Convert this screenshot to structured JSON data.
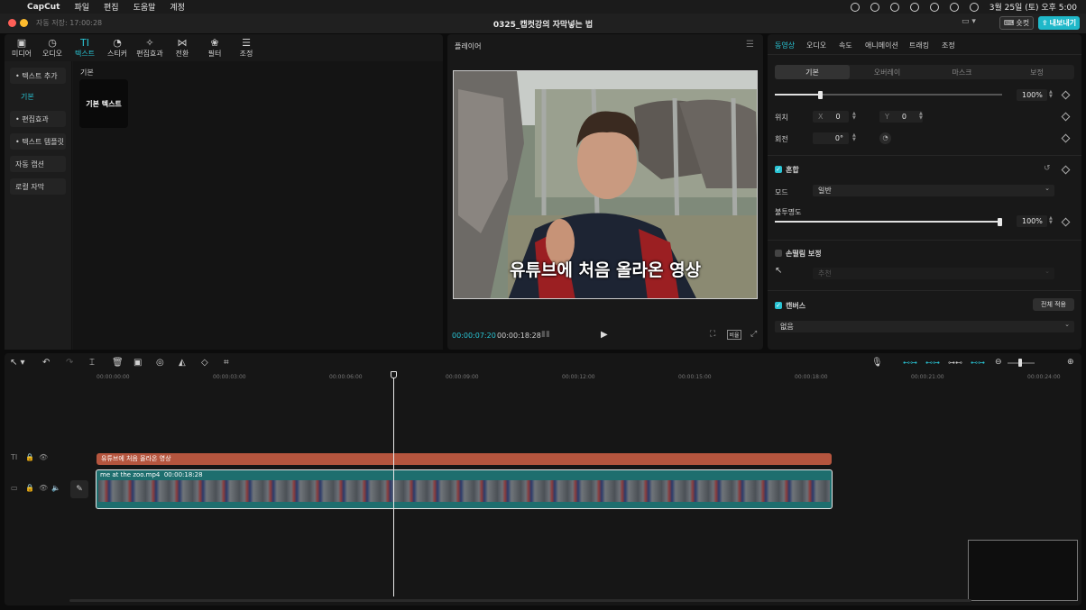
{
  "menubar": {
    "app": "CapCut",
    "items": [
      "파일",
      "편집",
      "도움말",
      "계정"
    ],
    "date_time": "3월 25일 (토) 오후 5:00"
  },
  "titlebar": {
    "autosave": "자동 저장: 17:00:28",
    "title": "0325_캡컷강의 자막넣는 법",
    "shortcut": "숏컷",
    "export": "내보내기"
  },
  "media_tabs": [
    {
      "label": "미디어",
      "icon": "media-icon"
    },
    {
      "label": "오디오",
      "icon": "audio-icon"
    },
    {
      "label": "텍스트",
      "icon": "text-icon"
    },
    {
      "label": "스티커",
      "icon": "sticker-icon"
    },
    {
      "label": "편집효과",
      "icon": "effects-icon"
    },
    {
      "label": "전환",
      "icon": "transition-icon"
    },
    {
      "label": "필터",
      "icon": "filter-icon"
    },
    {
      "label": "조정",
      "icon": "adjust-icon"
    }
  ],
  "media_sidebar": [
    {
      "label": "• 텍스트 추가"
    },
    {
      "label": "기본"
    },
    {
      "label": "• 편집효과"
    },
    {
      "label": "• 텍스트 템플릿"
    },
    {
      "label": "자동 캡션"
    },
    {
      "label": "로컬 자막"
    }
  ],
  "media_content": {
    "heading": "기본",
    "card": "기본 텍스트"
  },
  "player": {
    "title": "플레이어",
    "caption": "유튜브에 처음 올라온 영상",
    "time_current": "00:00:07:20",
    "time_total": "00:00:18:28",
    "ratio": "비율"
  },
  "inspector": {
    "tabs": [
      "동영상",
      "오디오",
      "속도",
      "애니메이션",
      "트래킹",
      "조정"
    ],
    "subtabs": [
      "기본",
      "오버레이",
      "마스크",
      "보정"
    ],
    "scale_value": "100%",
    "position_label": "위치",
    "x_label": "X",
    "x_value": "0",
    "y_label": "Y",
    "y_value": "0",
    "rotation_label": "회전",
    "rotation_value": "0°",
    "blend_label": "혼합",
    "mode_label": "모드",
    "mode_value": "일반",
    "opacity_label": "불투명도",
    "opacity_value": "100%",
    "stabilize_label": "손떨림 보정",
    "stabilize_value": "추천",
    "canvas_label": "캔버스",
    "apply_all": "전체 적용",
    "canvas_value": "없음"
  },
  "timeline": {
    "ruler": [
      "00:00:00:00",
      "00:00:03:00",
      "00:00:06:00",
      "00:00:09:00",
      "00:00:12:00",
      "00:00:15:00",
      "00:00:18:00",
      "00:00:21:00",
      "00:00:24:00"
    ],
    "text_clip": "유튜브에 처음 올라온 영상",
    "video_clip_name": "me at the zoo.mp4",
    "video_clip_duration": "00:00:18:28"
  }
}
